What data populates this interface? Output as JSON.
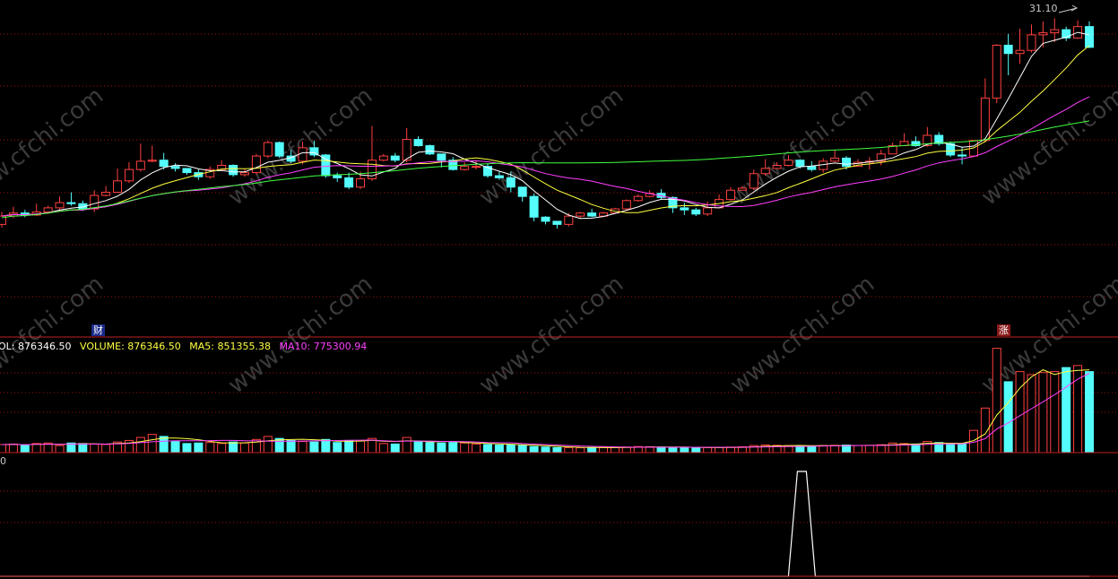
{
  "price_panel": {
    "high_label": "31.10",
    "event_marker_1": "财",
    "event_marker_2": "涨"
  },
  "volume_panel": {
    "legend": {
      "vol_prefix": "OL: ",
      "vol_value": "876346.50",
      "volume_prefix": "VOLUME: ",
      "volume_value": "876346.50",
      "ma5_prefix": "MA5: ",
      "ma5_value": "851355.38",
      "ma10_prefix": "MA10: ",
      "ma10_value": "775300.94"
    },
    "colors": {
      "vol": "#ffffff",
      "volume": "#ffff40",
      "ma5": "#ffff40",
      "ma10": "#ff40ff"
    }
  },
  "indicator_panel": {
    "zero_label": "0"
  },
  "watermark": "www.cfchi.com",
  "colors": {
    "background": "#000000",
    "up": "#ff4040",
    "down": "#54fcfc",
    "ma_white": "#ffffff",
    "ma_yellow": "#ffff40",
    "ma_magenta": "#ff40ff",
    "ma_green": "#40ff40",
    "grid": "#a01010",
    "separator": "#c02020"
  },
  "chart_data": {
    "type": "candlestick",
    "ylim": [
      5,
      32
    ],
    "high": 31.1,
    "candles": [
      [
        11.2,
        12.0,
        12.4,
        10.9
      ],
      [
        12.0,
        12.3,
        12.9,
        11.8
      ],
      [
        12.3,
        12.1,
        12.6,
        11.9
      ],
      [
        12.1,
        12.4,
        13.2,
        12.0
      ],
      [
        12.4,
        12.8,
        13.0,
        12.2
      ],
      [
        12.8,
        13.3,
        13.9,
        12.6
      ],
      [
        13.3,
        13.2,
        14.3,
        13.0
      ],
      [
        13.2,
        12.7,
        13.5,
        12.5
      ],
      [
        12.7,
        14.0,
        14.5,
        12.4
      ],
      [
        14.0,
        14.3,
        14.9,
        13.9
      ],
      [
        14.3,
        15.4,
        16.6,
        14.3
      ],
      [
        15.4,
        16.5,
        17.2,
        15.2
      ],
      [
        16.5,
        17.3,
        19.0,
        16.3
      ],
      [
        17.3,
        17.4,
        18.8,
        17.2
      ],
      [
        17.4,
        16.8,
        18.1,
        16.5
      ],
      [
        16.8,
        16.6,
        17.1,
        16.3
      ],
      [
        16.6,
        16.2,
        16.6,
        16.0
      ],
      [
        16.2,
        15.8,
        16.5,
        15.5
      ],
      [
        15.8,
        16.5,
        16.8,
        15.6
      ],
      [
        16.5,
        16.9,
        17.4,
        16.4
      ],
      [
        16.9,
        16.0,
        17.0,
        15.8
      ],
      [
        16.0,
        16.2,
        16.6,
        15.8
      ],
      [
        16.2,
        17.8,
        18.0,
        16.0
      ],
      [
        17.8,
        19.1,
        19.3,
        17.6
      ],
      [
        19.1,
        17.8,
        19.2,
        17.6
      ],
      [
        17.8,
        17.3,
        18.4,
        17.1
      ],
      [
        17.3,
        18.6,
        19.2,
        17.0
      ],
      [
        18.6,
        17.9,
        19.3,
        17.7
      ],
      [
        17.9,
        15.9,
        18.0,
        15.7
      ],
      [
        15.9,
        15.7,
        16.2,
        15.3
      ],
      [
        15.7,
        14.8,
        16.2,
        14.6
      ],
      [
        14.8,
        15.6,
        16.3,
        14.6
      ],
      [
        15.6,
        17.4,
        20.7,
        15.4
      ],
      [
        17.4,
        17.8,
        18.0,
        17.3
      ],
      [
        17.8,
        17.4,
        18.1,
        17.2
      ],
      [
        17.4,
        19.4,
        20.5,
        17.2
      ],
      [
        19.4,
        18.8,
        19.7,
        18.7
      ],
      [
        18.8,
        18.0,
        18.9,
        17.9
      ],
      [
        18.0,
        17.4,
        18.0,
        16.7
      ],
      [
        17.4,
        16.5,
        17.7,
        16.4
      ],
      [
        16.5,
        16.8,
        17.2,
        16.4
      ],
      [
        16.8,
        16.8,
        17.3,
        16.5
      ],
      [
        16.8,
        15.9,
        17.1,
        15.7
      ],
      [
        15.9,
        15.7,
        16.3,
        15.5
      ],
      [
        15.7,
        14.8,
        16.3,
        14.3
      ],
      [
        14.8,
        13.9,
        14.6,
        13.4
      ],
      [
        13.9,
        11.9,
        14.2,
        11.5
      ],
      [
        11.9,
        11.5,
        12.0,
        11.2
      ],
      [
        11.5,
        11.2,
        11.5,
        10.8
      ],
      [
        11.2,
        12.0,
        12.3,
        11.0
      ],
      [
        12.0,
        12.3,
        12.4,
        11.8
      ],
      [
        12.3,
        12.0,
        12.7,
        11.9
      ],
      [
        12.0,
        12.3,
        12.4,
        12.0
      ],
      [
        12.3,
        12.7,
        12.8,
        12.2
      ],
      [
        12.7,
        13.5,
        13.6,
        12.5
      ],
      [
        13.5,
        13.9,
        14.1,
        13.4
      ],
      [
        13.9,
        14.2,
        14.5,
        13.8
      ],
      [
        14.2,
        13.8,
        14.6,
        13.6
      ],
      [
        13.8,
        12.8,
        13.9,
        12.3
      ],
      [
        12.8,
        12.6,
        13.3,
        12.1
      ],
      [
        12.6,
        12.2,
        12.8,
        12.0
      ],
      [
        12.2,
        12.8,
        13.4,
        12.0
      ],
      [
        12.8,
        13.6,
        14.1,
        12.8
      ],
      [
        13.6,
        14.5,
        14.8,
        13.5
      ],
      [
        14.5,
        14.7,
        14.9,
        14.5
      ],
      [
        14.7,
        16.1,
        16.5,
        14.5
      ],
      [
        16.1,
        16.6,
        17.5,
        15.9
      ],
      [
        16.6,
        16.9,
        17.2,
        16.6
      ],
      [
        16.9,
        17.4,
        17.9,
        16.8
      ],
      [
        17.4,
        16.8,
        17.5,
        16.6
      ],
      [
        16.8,
        16.5,
        17.3,
        16.3
      ],
      [
        16.5,
        17.3,
        17.6,
        16.2
      ],
      [
        17.3,
        17.6,
        18.4,
        17.2
      ],
      [
        17.6,
        16.8,
        17.8,
        16.5
      ],
      [
        16.8,
        17.2,
        17.5,
        16.8
      ],
      [
        17.2,
        17.3,
        17.7,
        16.5
      ],
      [
        17.3,
        18.0,
        18.4,
        16.9
      ],
      [
        18.0,
        18.8,
        19.1,
        18.0
      ],
      [
        18.8,
        19.2,
        20.0,
        18.8
      ],
      [
        19.2,
        18.8,
        19.7,
        18.7
      ],
      [
        18.8,
        19.8,
        20.6,
        18.7
      ],
      [
        19.8,
        19.0,
        20.1,
        18.8
      ],
      [
        19.0,
        17.9,
        19.2,
        17.7
      ],
      [
        17.9,
        17.8,
        18.7,
        17.0
      ],
      [
        17.8,
        19.3,
        19.3,
        17.7
      ],
      [
        19.3,
        23.4,
        25.3,
        19.1
      ],
      [
        23.4,
        28.5,
        28.6,
        22.9
      ],
      [
        28.5,
        27.7,
        29.6,
        25.6
      ],
      [
        27.7,
        28.0,
        30.1,
        26.7
      ],
      [
        28.0,
        29.5,
        30.5,
        27.8
      ],
      [
        29.5,
        29.7,
        30.8,
        28.3
      ],
      [
        29.7,
        30.0,
        31.1,
        28.8
      ],
      [
        30.0,
        29.2,
        30.3,
        28.9
      ],
      [
        29.2,
        30.3,
        30.9,
        29.1
      ],
      [
        30.3,
        28.3,
        30.8,
        28.2
      ]
    ],
    "volume": {
      "ylim": [
        0,
        1000000
      ],
      "values": [
        80000,
        85000,
        72000,
        90000,
        95000,
        70000,
        95000,
        90000,
        85000,
        80000,
        105000,
        120000,
        150000,
        180000,
        160000,
        110000,
        90000,
        95000,
        100000,
        90000,
        105000,
        95000,
        130000,
        160000,
        140000,
        120000,
        110000,
        105000,
        130000,
        100000,
        120000,
        115000,
        140000,
        90000,
        85000,
        150000,
        110000,
        100000,
        95000,
        100000,
        95000,
        85000,
        80000,
        75000,
        80000,
        70000,
        60000,
        55000,
        50000,
        50000,
        48000,
        50000,
        52000,
        50000,
        55000,
        60000,
        58000,
        55000,
        50000,
        50000,
        48000,
        50000,
        52000,
        55000,
        58000,
        70000,
        75000,
        72000,
        70000,
        65000,
        65000,
        70000,
        72000,
        75000,
        70000,
        72000,
        78000,
        95000,
        90000,
        85000,
        110000,
        100000,
        80000,
        85000,
        220000,
        440000,
        1030000,
        700000,
        800000,
        770000,
        790000,
        800000,
        840000,
        860000,
        800000
      ]
    },
    "indicator": {
      "ylim": [
        0,
        1
      ],
      "pulse_at": 69
    }
  }
}
